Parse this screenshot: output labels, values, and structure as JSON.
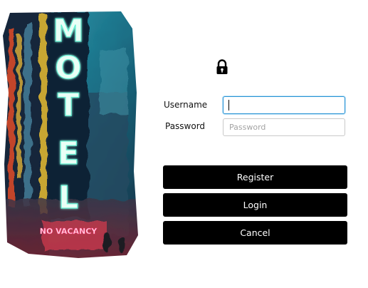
{
  "poster": {
    "sign_text": "MOTEL",
    "vacancy_text": "NO VACANCY"
  },
  "form": {
    "username_label": "Username",
    "username_value": "",
    "username_placeholder": "",
    "password_label": "Password",
    "password_value": "",
    "password_placeholder": "Password"
  },
  "buttons": {
    "register": "Register",
    "login": "Login",
    "cancel": "Cancel"
  },
  "colors": {
    "button_bg": "#000000",
    "button_text": "#ffffff",
    "focus_border": "#2a93d5"
  },
  "icons": {
    "header": "lock-icon"
  }
}
